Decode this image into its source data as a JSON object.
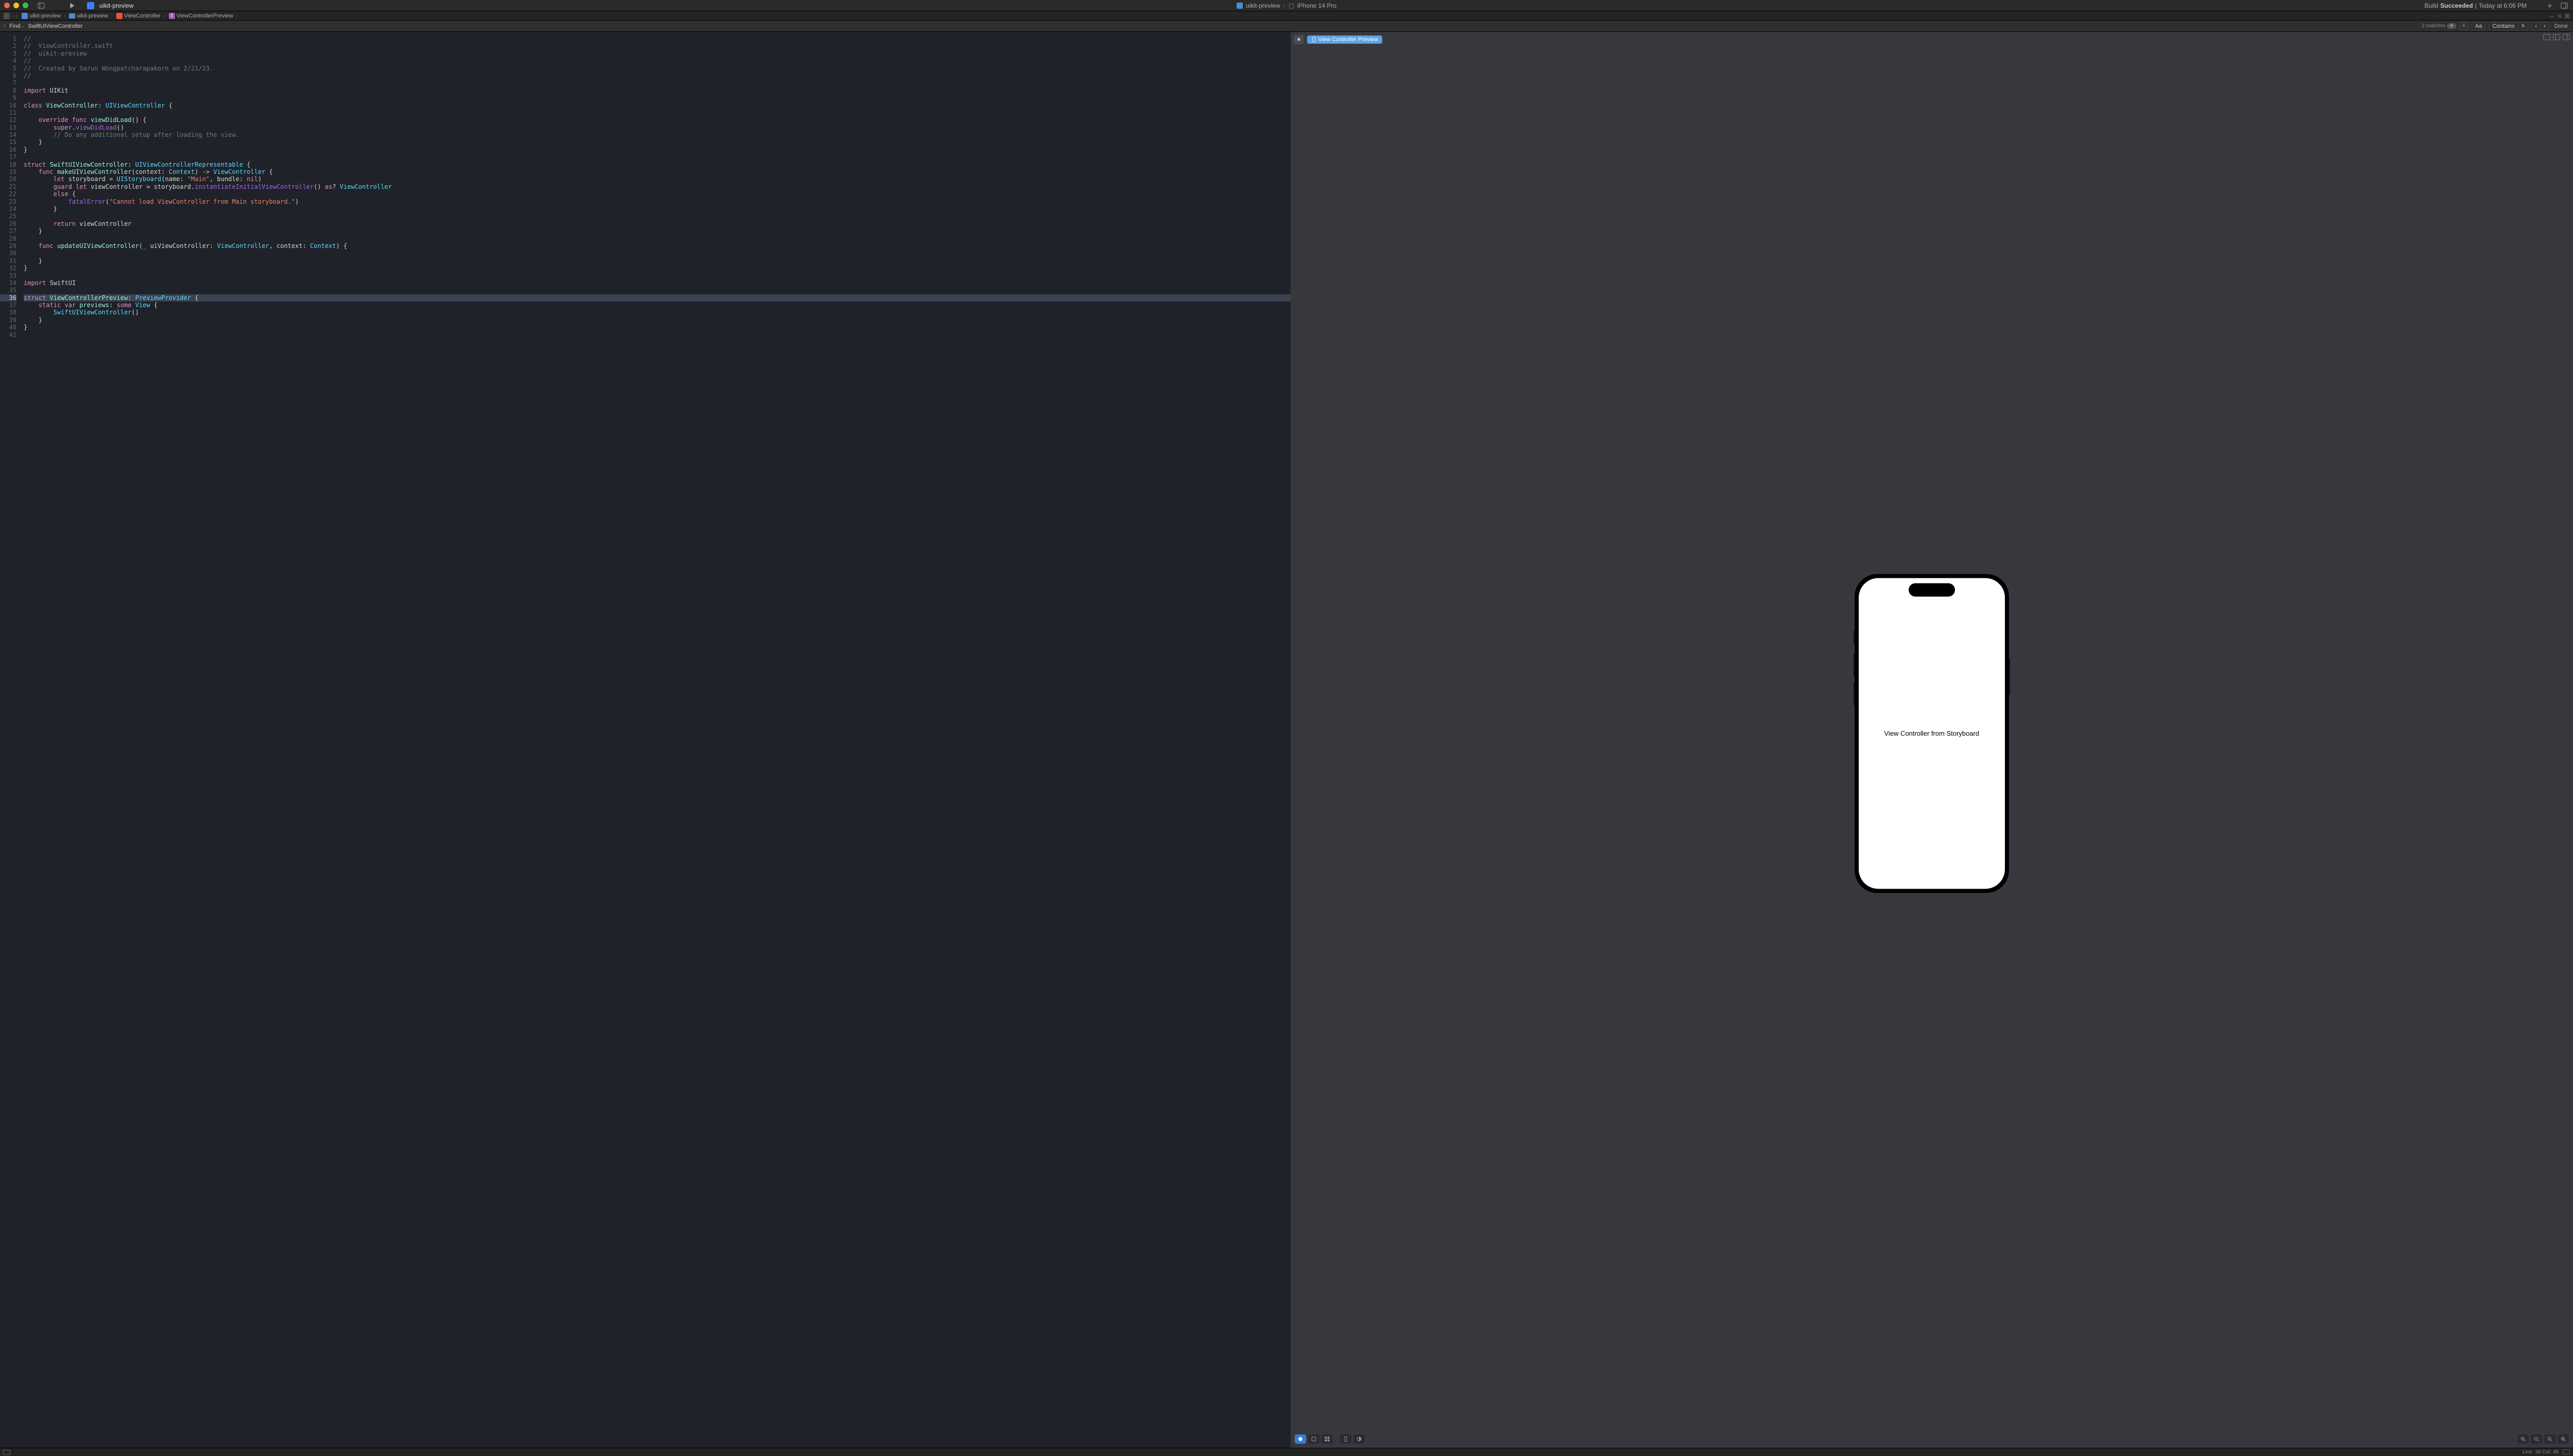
{
  "titlebar": {
    "project_name": "uikit-preview",
    "target_scheme": "uikit-preview",
    "target_device": "iPhone 14 Pro",
    "build_status_prefix": "Build",
    "build_status_result": "Succeeded",
    "build_status_time": "Today at 6:06 PM"
  },
  "breadcrumb": {
    "items": [
      "uikit-preview",
      "uikit-preview",
      "ViewController",
      "ViewControllerPreview"
    ]
  },
  "findbar": {
    "mode_label": "Find",
    "query": "SwiftUIViewController",
    "matches_label": "2 matches",
    "case_label": "Aa",
    "contains_label": "Contains",
    "done_label": "Done"
  },
  "code": {
    "lines": [
      {
        "n": 1,
        "html": "<span class='c-comment'>//</span>"
      },
      {
        "n": 2,
        "html": "<span class='c-comment'>//  ViewController.swift</span>"
      },
      {
        "n": 3,
        "html": "<span class='c-comment'>//  uikit-preview</span>"
      },
      {
        "n": 4,
        "html": "<span class='c-comment'>//</span>"
      },
      {
        "n": 5,
        "html": "<span class='c-comment'>//  Created by Sarun Wongpatcharapakorn on 2/21/23.</span>"
      },
      {
        "n": 6,
        "html": "<span class='c-comment'>//</span>"
      },
      {
        "n": 7,
        "html": ""
      },
      {
        "n": 8,
        "html": "<span class='c-keyword'>import</span> <span class='c-plain'>UIKit</span>"
      },
      {
        "n": 9,
        "html": ""
      },
      {
        "n": 10,
        "html": "<span class='c-keyword'>class</span> <span class='c-type'>ViewController</span><span class='c-plain'>:</span> <span class='c-reftype'>UIViewController</span> <span class='c-plain'>{</span>"
      },
      {
        "n": 11,
        "html": ""
      },
      {
        "n": 12,
        "html": "    <span class='c-keyword'>override</span> <span class='c-keyword'>func</span> <span class='c-type'>viewDidLoad</span><span class='c-plain'>() {</span>"
      },
      {
        "n": 13,
        "html": "        <span class='c-keyword'>super</span><span class='c-plain'>.</span><span class='c-func'>viewDidLoad</span><span class='c-plain'>()</span>"
      },
      {
        "n": 14,
        "html": "        <span class='c-comment'>// Do any additional setup after loading the view.</span>"
      },
      {
        "n": 15,
        "html": "    <span class='c-plain'>}</span>"
      },
      {
        "n": 16,
        "html": "<span class='c-plain'>}</span>"
      },
      {
        "n": 17,
        "html": ""
      },
      {
        "n": 18,
        "html": "<span class='c-keyword'>struct</span> <span class='c-type'>SwiftUIViewController</span><span class='c-plain'>:</span> <span class='c-reftype'>UIViewControllerRepresentable</span> <span class='c-plain'>{</span>"
      },
      {
        "n": 19,
        "html": "    <span class='c-keyword'>func</span> <span class='c-type'>makeUIViewController</span><span class='c-plain'>(context:</span> <span class='c-reftype'>Context</span><span class='c-plain'>) -&gt;</span> <span class='c-reftype'>ViewController</span> <span class='c-plain'>{</span>"
      },
      {
        "n": 20,
        "html": "        <span class='c-keyword'>let</span> <span class='c-plain'>storyboard =</span> <span class='c-reftype'>UIStoryboard</span><span class='c-plain'>(name:</span> <span class='c-string'>\"Main\"</span><span class='c-plain'>, bundle:</span> <span class='c-keyword'>nil</span><span class='c-plain'>)</span>"
      },
      {
        "n": 21,
        "html": "        <span class='c-keyword'>guard</span> <span class='c-keyword'>let</span> <span class='c-plain'>viewController = storyboard.</span><span class='c-func'>instantiateInitialViewController</span><span class='c-plain'>()</span> <span class='c-keyword'>as</span><span class='c-plain'>?</span> <span class='c-reftype'>ViewController</span>"
      },
      {
        "n": 22,
        "html": "        <span class='c-keyword'>else</span> <span class='c-plain'>{</span>"
      },
      {
        "n": 23,
        "html": "            <span class='c-func'>fatalError</span><span class='c-plain'>(</span><span class='c-string'>\"Cannot load ViewController from Main storyboard.\"</span><span class='c-plain'>)</span>"
      },
      {
        "n": 24,
        "html": "        <span class='c-plain'>}</span>"
      },
      {
        "n": 25,
        "html": ""
      },
      {
        "n": 26,
        "html": "        <span class='c-keyword'>return</span> <span class='c-plain'>viewController</span>"
      },
      {
        "n": 27,
        "html": "    <span class='c-plain'>}</span>"
      },
      {
        "n": 28,
        "html": ""
      },
      {
        "n": 29,
        "html": "    <span class='c-keyword'>func</span> <span class='c-type'>updateUIViewController</span><span class='c-plain'>(</span><span class='c-keyword'>_</span> <span class='c-plain'>uiViewController:</span> <span class='c-reftype'>ViewController</span><span class='c-plain'>, context:</span> <span class='c-reftype'>Context</span><span class='c-plain'>) {</span>"
      },
      {
        "n": 30,
        "html": ""
      },
      {
        "n": 31,
        "html": "    <span class='c-plain'>}</span>"
      },
      {
        "n": 32,
        "html": "<span class='c-plain'>}</span>"
      },
      {
        "n": 33,
        "html": ""
      },
      {
        "n": 34,
        "html": "<span class='c-keyword'>import</span> <span class='c-plain'>SwiftUI</span>"
      },
      {
        "n": 35,
        "html": ""
      },
      {
        "n": 36,
        "html": "<span class='c-keyword'>struct</span> <span class='c-type'>ViewControllerPreview</span><span class='c-plain'>:</span> <span class='c-reftype'>PreviewProvider</span> <span class='c-plain'>{</span>",
        "hl": true
      },
      {
        "n": 37,
        "html": "    <span class='c-keyword'>static</span> <span class='c-keyword'>var</span> <span class='c-type'>previews</span><span class='c-plain'>:</span> <span class='c-keyword'>some</span> <span class='c-reftype'>View</span> <span class='c-plain'>{</span>"
      },
      {
        "n": 38,
        "html": "        <span class='c-reftype'>SwiftUIViewController</span><span class='c-plain'>()</span>"
      },
      {
        "n": 39,
        "html": "    <span class='c-plain'>}</span>"
      },
      {
        "n": 40,
        "html": "<span class='c-plain'>}</span>"
      },
      {
        "n": 41,
        "html": ""
      }
    ]
  },
  "preview": {
    "label": "View Controller Preview",
    "phone_text": "View Controller from Storyboard"
  },
  "statusbar": {
    "line_col": "Line: 36  Col: 48"
  }
}
